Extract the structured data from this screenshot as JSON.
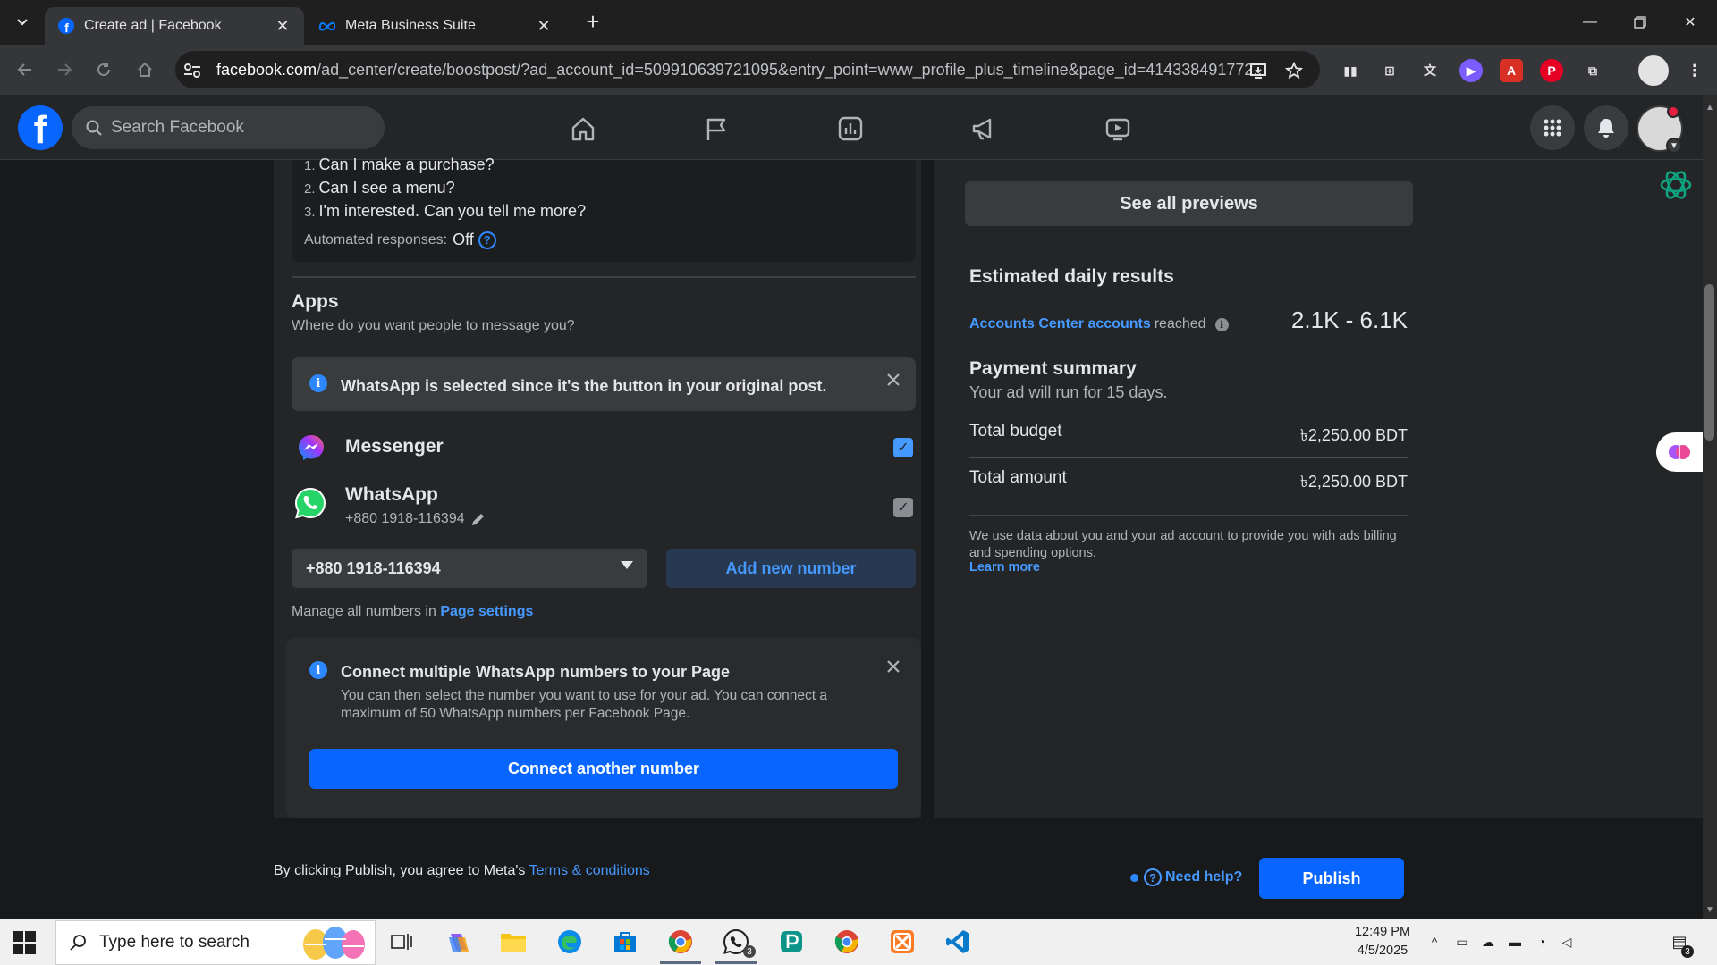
{
  "browser": {
    "tabs": [
      {
        "title": "Create ad | Facebook",
        "active": true,
        "icon": "facebook-favicon"
      },
      {
        "title": "Meta Business Suite",
        "active": false,
        "icon": "meta-favicon"
      }
    ],
    "url_host": "facebook.com",
    "url_path": "/ad_center/create/boostpost/?ad_account_id=509910639721095&entry_point=www_profile_plus_timeline&page_id=414338491772..."
  },
  "fb_header": {
    "search_placeholder": "Search Facebook"
  },
  "left": {
    "qa_items": [
      {
        "num": "1.",
        "text": "Can I make a purchase?"
      },
      {
        "num": "2.",
        "text": "Can I see a menu?"
      },
      {
        "num": "3.",
        "text": "I'm interested. Can you tell me more?"
      }
    ],
    "automated_label": "Automated responses:",
    "automated_value": "Off",
    "apps_title": "Apps",
    "apps_subtitle": "Where do you want people to message you?",
    "notice": "WhatsApp is selected since it's the button in your original post.",
    "messenger_label": "Messenger",
    "messenger_checked": true,
    "whatsapp_label": "WhatsApp",
    "whatsapp_phone": "+880 1918-116394",
    "whatsapp_checked": true,
    "selected_number": "+880 1918-116394",
    "add_number_label": "Add new number",
    "manage_prefix": "Manage all numbers in",
    "manage_link": "Page settings",
    "connect_title": "Connect multiple WhatsApp numbers to your Page",
    "connect_body": "You can then select the number you want to use for your ad. You can connect a maximum of 50 WhatsApp numbers per Facebook Page.",
    "connect_button": "Connect another number"
  },
  "right": {
    "see_all_previews": "See all previews",
    "estimated_title": "Estimated daily results",
    "accounts_link": "Accounts Center accounts",
    "reached_label": "reached",
    "reach_value": "2.1K - 6.1K",
    "payment_title": "Payment summary",
    "payment_subtitle": "Your ad will run for 15 days.",
    "total_budget_label": "Total budget",
    "total_budget_value": "৳2,250.00 BDT",
    "total_amount_label": "Total amount",
    "total_amount_value": "৳2,250.00 BDT",
    "data_note": "We use data about you and your ad account to provide you with ads billing and spending options.",
    "learn_more": "Learn more"
  },
  "footer": {
    "agree_prefix": "By clicking Publish, you agree to Meta's",
    "terms_link": "Terms & conditions",
    "need_help": "Need help?",
    "publish": "Publish"
  },
  "taskbar": {
    "search_placeholder": "Type here to search",
    "time": "12:49 PM",
    "date": "4/5/2025",
    "whatsapp_badge": "3",
    "notifications_badge": "3"
  },
  "colors": {
    "facebook_blue": "#0866ff",
    "link_blue": "#4599ff",
    "panel_bg": "#242526",
    "page_bg": "#18191a"
  }
}
